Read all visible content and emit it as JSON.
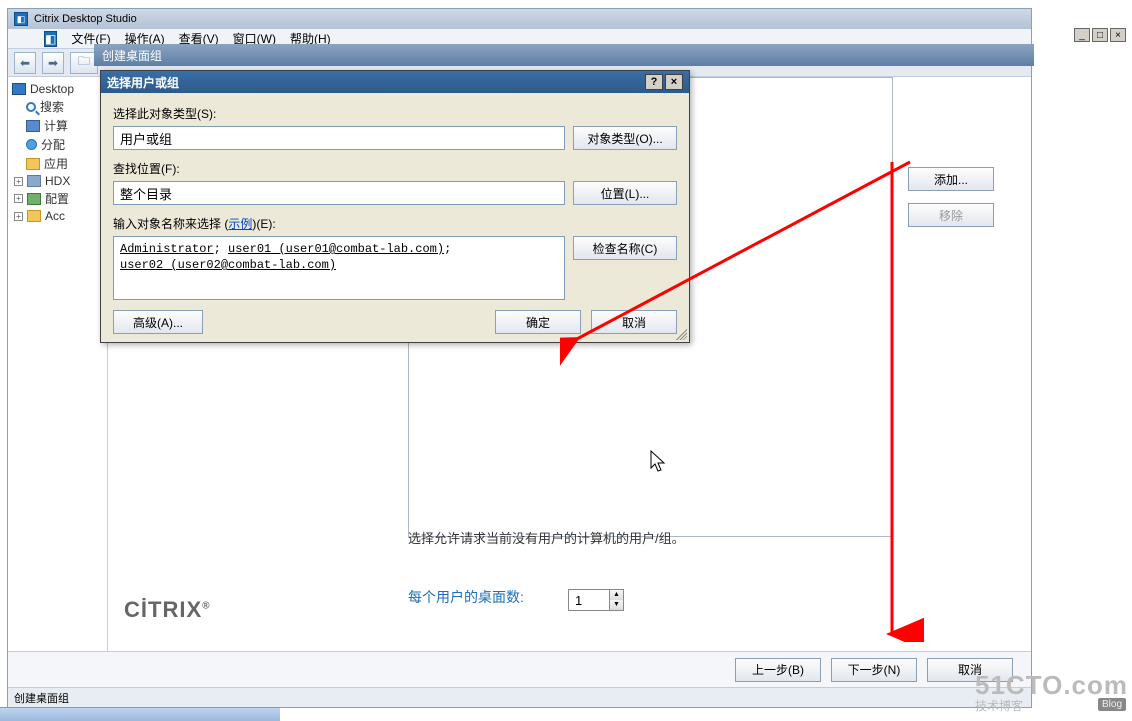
{
  "app": {
    "title_suffix": "Citrix Desktop Studio",
    "menus": {
      "file": "文件(F)",
      "action": "操作(A)",
      "view": "查看(V)",
      "window": "窗口(W)",
      "help": "帮助(H)"
    }
  },
  "tree": {
    "root": "Desktop",
    "items": [
      {
        "label": "搜索"
      },
      {
        "label": "计算"
      },
      {
        "label": "分配"
      },
      {
        "label": "应用"
      },
      {
        "label": "HDX"
      },
      {
        "label": "配置"
      },
      {
        "label": "Acc"
      }
    ]
  },
  "parent_dialog": {
    "title": "创建桌面组"
  },
  "main": {
    "note": "选择允许请求当前没有用户的计算机的用户/组。",
    "desktops_label": "每个用户的桌面数:",
    "desktops_value": "1",
    "side": {
      "add": "添加...",
      "remove": "移除"
    },
    "buttons": {
      "back": "上一步(B)",
      "next": "下一步(N)",
      "cancel": "取消"
    },
    "citrix": "CİTRIX",
    "status": "创建桌面组"
  },
  "dialog": {
    "title": "选择用户或组",
    "help_btn": "?",
    "close_btn": "×",
    "object_type_label": "选择此对象类型(S):",
    "object_type_value": "用户或组",
    "object_type_btn": "对象类型(O)...",
    "location_label": "查找位置(F):",
    "location_value": "整个目录",
    "location_btn": "位置(L)...",
    "names_label_prefix": "输入对象名称来选择 (",
    "names_label_link": "示例",
    "names_label_suffix": ")(E):",
    "names_line1_a": "Administrator",
    "names_line1_b": "user01  (user01@combat-lab.com)",
    "names_line2": "user02  (user02@combat-lab.com)",
    "check_names_btn": "检查名称(C)",
    "advanced_btn": "高级(A)...",
    "ok_btn": "确定",
    "cancel_btn": "取消"
  },
  "watermark": {
    "big": "51CTO.com",
    "small": "技术博客",
    "tag": "Blog"
  }
}
